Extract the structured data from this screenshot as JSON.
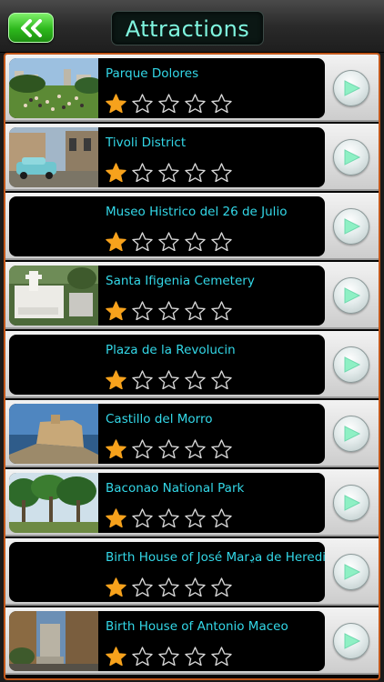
{
  "header": {
    "back_icon": "double-chevron-left-icon",
    "title": "Attractions"
  },
  "colors": {
    "accent": "#7ff5df",
    "link_text": "#33d8e8",
    "frame": "#c2571a",
    "star_filled": "#f7a21c",
    "back_button": "#2db81c"
  },
  "attractions": [
    {
      "name": "Parque Dolores",
      "rating": 1,
      "max_rating": 5,
      "has_photo": true
    },
    {
      "name": "Tivoli District",
      "rating": 1,
      "max_rating": 5,
      "has_photo": true
    },
    {
      "name": "Museo Histrico del 26 de Julio",
      "rating": 1,
      "max_rating": 5,
      "has_photo": false
    },
    {
      "name": "Santa Ifigenia Cemetery",
      "rating": 1,
      "max_rating": 5,
      "has_photo": true
    },
    {
      "name": "Plaza de la Revolucin",
      "rating": 1,
      "max_rating": 5,
      "has_photo": false
    },
    {
      "name": "Castillo del Morro",
      "rating": 1,
      "max_rating": 5,
      "has_photo": true
    },
    {
      "name": "Baconao National Park",
      "rating": 1,
      "max_rating": 5,
      "has_photo": true
    },
    {
      "name": "Birth House of José Marڍa de Heredia",
      "rating": 1,
      "max_rating": 5,
      "has_photo": false
    },
    {
      "name": "Birth House of Antonio Maceo",
      "rating": 1,
      "max_rating": 5,
      "has_photo": true
    }
  ]
}
